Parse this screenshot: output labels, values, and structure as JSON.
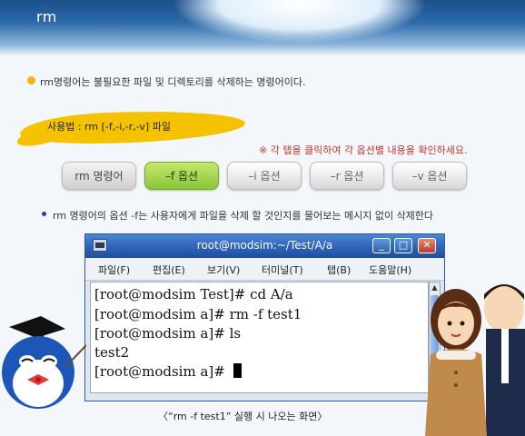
{
  "page": {
    "title": "rm",
    "intro": "rm명령어는 불필요한 파일 및 디렉토리를 삭제하는 명령어이다.",
    "usage": "사용법 : rm [-f,-i,-r,-v] 파일",
    "hint": "※ 각 탭을 클릭하여 각 옵션별 내용을 확인하세요.",
    "note": "rm 명령어의 옵션 -f는 사용자에게 파일을 삭제 할 것인지를 물어보는 메시지 없이 삭제한다",
    "caption": "〈“rm  -f  test1” 실행 시 나오는 화면〉"
  },
  "options": [
    {
      "label": "rm 명령어",
      "state": "normal"
    },
    {
      "label": "–f 옵션",
      "state": "active"
    },
    {
      "label": "–i 옵션",
      "state": "normal"
    },
    {
      "label": "–r 옵션",
      "state": "normal"
    },
    {
      "label": "–v 옵션",
      "state": "normal"
    }
  ],
  "window": {
    "title": "root@modsim:~/Test/A/a",
    "buttons": {
      "minimize": "_",
      "maximize": "□",
      "close": "✕"
    },
    "menu": [
      "파일(F)",
      "편집(E)",
      "보기(V)",
      "터미널(T)",
      "탭(B)",
      "도움말(H)"
    ],
    "terminal_lines": [
      "[root@modsim Test]# cd A/a",
      "[root@modsim a]# rm -f test1",
      "[root@modsim a]# ls",
      "test2",
      "[root@modsim a]# "
    ]
  },
  "colors": {
    "accent_yellow": "#f5c200",
    "active_tab": "#8bc53a",
    "titlebar_blue": "#2d63b8"
  }
}
